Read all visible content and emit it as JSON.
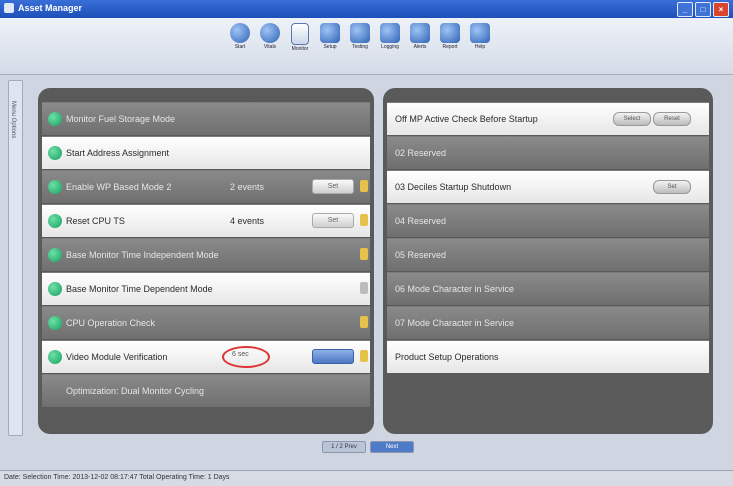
{
  "window": {
    "title": "Asset Manager"
  },
  "toolbar": {
    "tools": [
      {
        "label": "Start",
        "icon": "play-icon"
      },
      {
        "label": "Vitals",
        "icon": "gauge-icon"
      },
      {
        "label": "Monitor",
        "icon": "document-icon"
      },
      {
        "label": "Setup",
        "icon": "settings-icon"
      },
      {
        "label": "Testing",
        "icon": "chart-icon"
      },
      {
        "label": "Logging",
        "icon": "log-icon"
      },
      {
        "label": "Alerts",
        "icon": "wand-icon"
      },
      {
        "label": "Report",
        "icon": "report-icon"
      },
      {
        "label": "Help",
        "icon": "help-icon"
      }
    ]
  },
  "sidebar": {
    "label": "Menu Options"
  },
  "left_panel": {
    "rows": [
      {
        "label": "Monitor Fuel Storage Mode",
        "style": "dark"
      },
      {
        "label": "Start Address Assignment",
        "style": "light"
      },
      {
        "label": "Enable WP Based Mode 2",
        "style": "dark",
        "right_text": "2 events",
        "field": "Set",
        "lock": "yellow"
      },
      {
        "label": "Reset CPU TS",
        "style": "light",
        "right_text": "4 events",
        "field": "Set",
        "lock": "yellow"
      },
      {
        "label": "Base Monitor Time Independent Mode",
        "style": "dark",
        "lock": "yellow"
      },
      {
        "label": "Base Monitor Time Dependent Mode",
        "style": "light",
        "lock": "grey"
      },
      {
        "label": "CPU Operation Check",
        "style": "dark",
        "lock": "yellow"
      },
      {
        "label": "Video Module Verification",
        "style": "light",
        "highlight_text": "6 sec",
        "field": "",
        "lock": "yellow"
      },
      {
        "label": "Optimization: Dual Monitor Cycling",
        "style": "dark",
        "no_bullet": true
      }
    ]
  },
  "right_panel": {
    "rows": [
      {
        "label": "Off MP Active Check Before Startup",
        "style": "light",
        "buttons": [
          "Select",
          "Reset"
        ]
      },
      {
        "label": "02 Reserved",
        "style": "dark"
      },
      {
        "label": "03 Deciles Startup Shutdown",
        "style": "light",
        "buttons": [
          "Set"
        ]
      },
      {
        "label": "04 Reserved",
        "style": "dark"
      },
      {
        "label": "05 Reserved",
        "style": "dark"
      },
      {
        "label": "06 Mode Character in Service",
        "style": "dark"
      },
      {
        "label": "07 Mode Character in Service",
        "style": "dark"
      },
      {
        "label": "Product Setup Operations",
        "style": "light"
      }
    ]
  },
  "pager": {
    "pages": [
      "1 / 2 Prev",
      "Next"
    ]
  },
  "statusbar": {
    "text": "Date: Selection Time: 2013-12-02 08:17:47   Total Operating Time: 1 Days"
  }
}
